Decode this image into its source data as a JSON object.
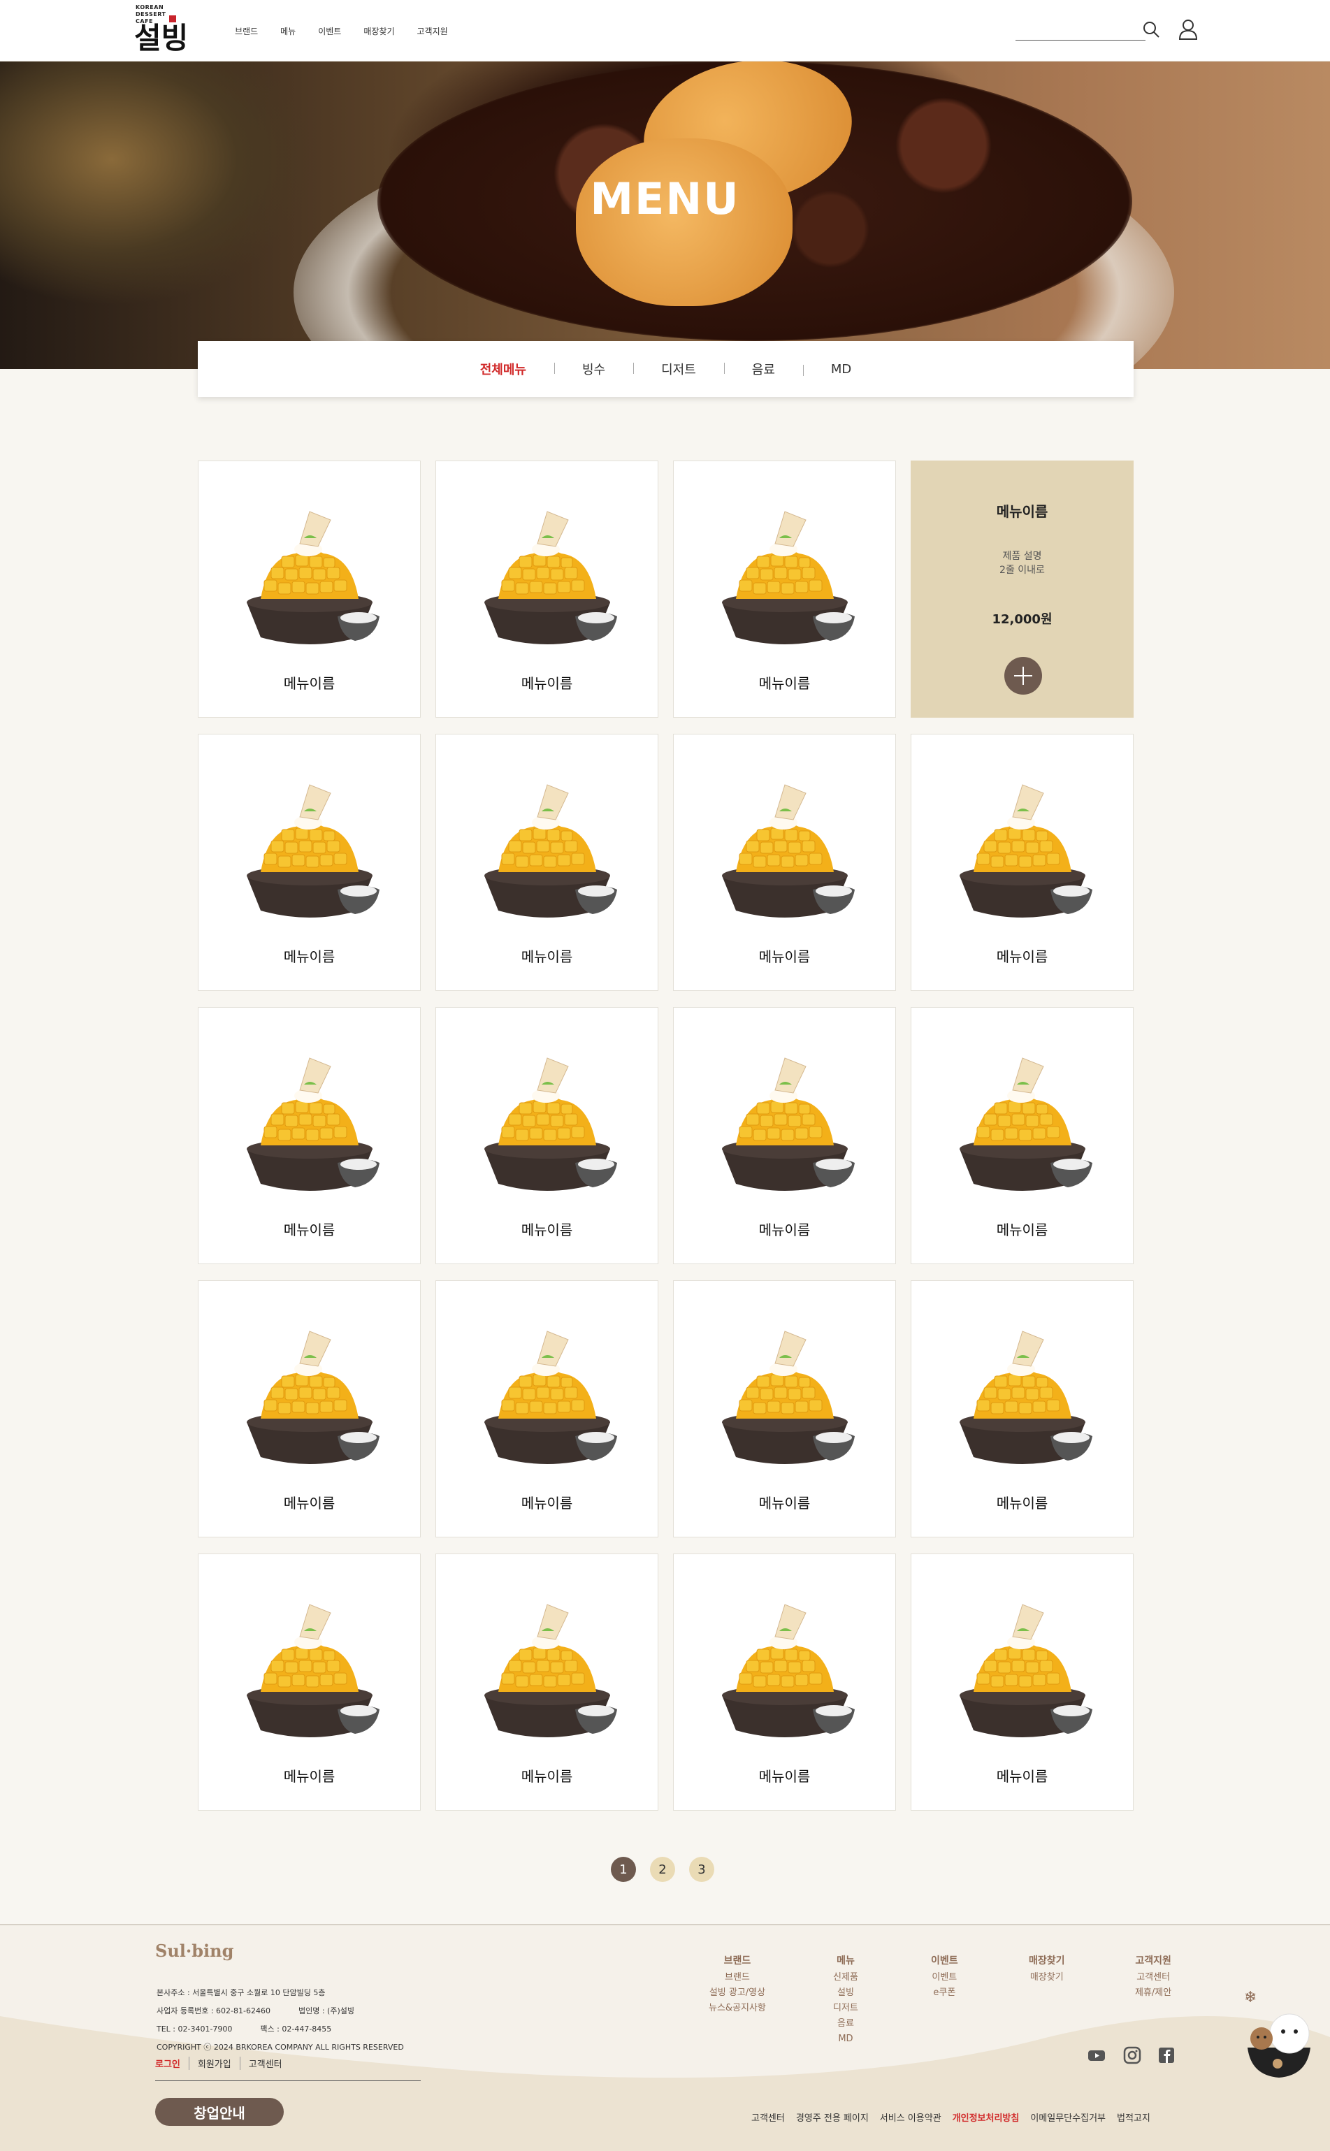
{
  "header": {
    "logo_small_lines": [
      "KOREAN",
      "DESSERT",
      "CAFE"
    ],
    "logo_text": "설빙",
    "nav": [
      "브랜드",
      "메뉴",
      "이벤트",
      "매장찾기",
      "고객지원"
    ],
    "search_value": ""
  },
  "hero": {
    "title": "MENU"
  },
  "tabs": [
    {
      "label": "전체메뉴",
      "active": true
    },
    {
      "label": "빙수",
      "active": false
    },
    {
      "label": "디저트",
      "active": false
    },
    {
      "label": "음료",
      "active": false
    },
    {
      "label": "MD",
      "active": false
    }
  ],
  "menu_items": [
    {
      "name": "메뉴이름"
    },
    {
      "name": "메뉴이름"
    },
    {
      "name": "메뉴이름"
    },
    {
      "name": "메뉴이름",
      "hover": true,
      "description": "제품 설명\n2줄 이내로",
      "price": "12,000원"
    },
    {
      "name": "메뉴이름"
    },
    {
      "name": "메뉴이름"
    },
    {
      "name": "메뉴이름"
    },
    {
      "name": "메뉴이름"
    },
    {
      "name": "메뉴이름"
    },
    {
      "name": "메뉴이름"
    },
    {
      "name": "메뉴이름"
    },
    {
      "name": "메뉴이름"
    },
    {
      "name": "메뉴이름"
    },
    {
      "name": "메뉴이름"
    },
    {
      "name": "메뉴이름"
    },
    {
      "name": "메뉴이름"
    },
    {
      "name": "메뉴이름"
    },
    {
      "name": "메뉴이름"
    },
    {
      "name": "메뉴이름"
    },
    {
      "name": "메뉴이름"
    }
  ],
  "pagination": {
    "pages": [
      "1",
      "2",
      "3"
    ],
    "current": "1"
  },
  "footer": {
    "logo": "Sul·bing",
    "address": "본사주소 : 서울특별시 중구 소월로 10 단암빌딩 5층",
    "biz_no": "사업자 등록번호 : 602-81-62460",
    "corp": "법인명 : (주)설빙",
    "tel": "TEL : 02-3401-7900",
    "fax": "팩스 : 02-447-8455",
    "copyright": "COPYRIGHT ⓒ 2024 BRKOREA COMPANY ALL RIGHTS RESERVED",
    "links": [
      "로그인",
      "회원가입",
      "고객센터"
    ],
    "franchise_button": "창업안내",
    "nav_columns": [
      {
        "title": "브랜드",
        "items": [
          "브랜드",
          "설빙 광고/영상",
          "뉴스&공지사항"
        ]
      },
      {
        "title": "메뉴",
        "items": [
          "신제품",
          "설빙",
          "디저트",
          "음료",
          "MD"
        ]
      },
      {
        "title": "이벤트",
        "items": [
          "이벤트",
          "e쿠폰"
        ]
      },
      {
        "title": "매장찾기",
        "items": [
          "매장찾기"
        ]
      },
      {
        "title": "고객지원",
        "items": [
          "고객센터",
          "제휴/제안"
        ]
      }
    ],
    "bottom_links": [
      "고객센터",
      "경영주 전용 페이지",
      "서비스 이용약관",
      "개인정보처리방침",
      "이메일무단수집거부",
      "법적고지"
    ],
    "highlight_link": "개인정보처리방침",
    "sns": [
      "youtube-icon",
      "instagram-icon",
      "facebook-icon"
    ]
  },
  "colors": {
    "accent_red": "#d12a2a",
    "brown": "#6e5a4f",
    "beige": "#e2d5b5",
    "bg": "#f8f6f1"
  }
}
